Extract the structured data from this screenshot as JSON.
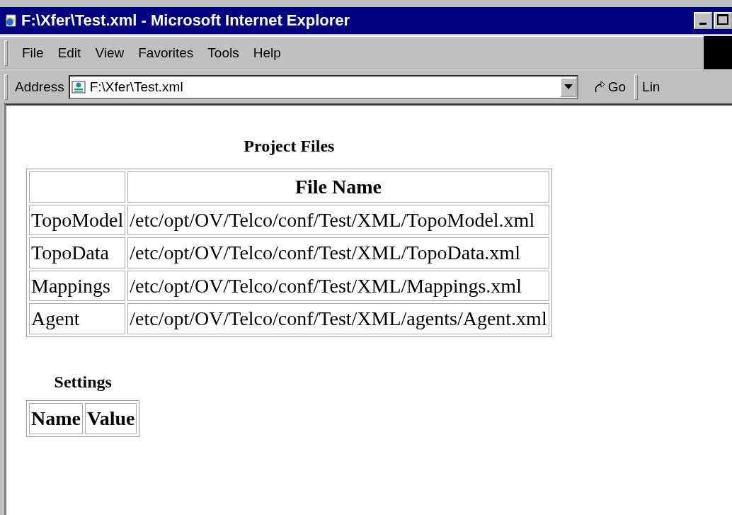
{
  "window": {
    "title": "F:\\Xfer\\Test.xml - Microsoft Internet Explorer"
  },
  "menu": [
    "File",
    "Edit",
    "View",
    "Favorites",
    "Tools",
    "Help"
  ],
  "address_bar": {
    "label": "Address",
    "value": "F:\\Xfer\\Test.xml",
    "go": "Go",
    "links": "Lin"
  },
  "project_files": {
    "title": "Project Files",
    "columns": [
      "",
      "File Name"
    ],
    "rows": [
      [
        "TopoModel",
        "/etc/opt/OV/Telco/conf/Test/XML/TopoModel.xml"
      ],
      [
        "TopoData",
        "/etc/opt/OV/Telco/conf/Test/XML/TopoData.xml"
      ],
      [
        "Mappings",
        "/etc/opt/OV/Telco/conf/Test/XML/Mappings.xml"
      ],
      [
        "Agent",
        "/etc/opt/OV/Telco/conf/Test/XML/agents/Agent.xml"
      ]
    ]
  },
  "settings": {
    "title": "Settings",
    "columns": [
      "Name",
      "Value"
    ]
  }
}
